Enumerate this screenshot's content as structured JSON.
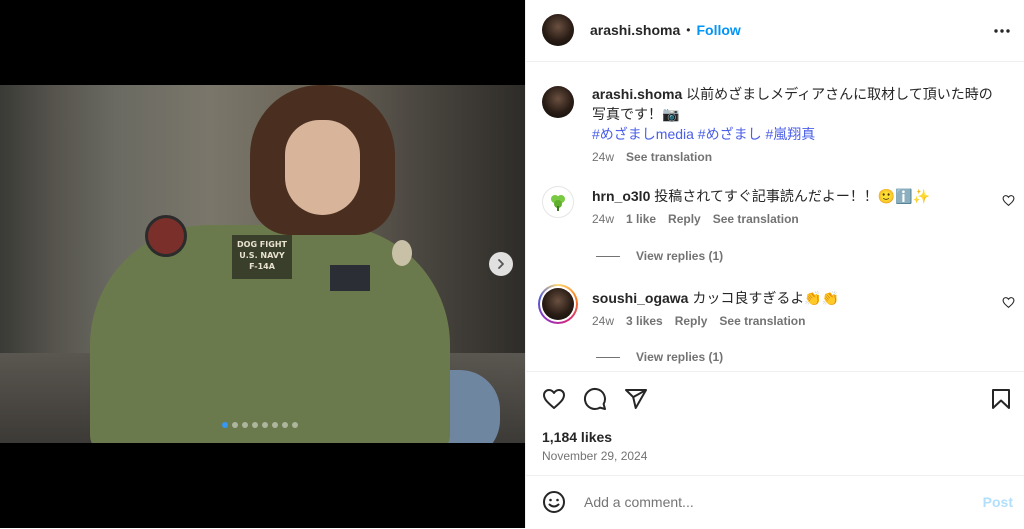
{
  "post": {
    "username": "arashi.shoma",
    "follow_label": "Follow",
    "separator": "•",
    "caption_text": "以前めざましメディアさんに取材して頂いた時の写真です！📷",
    "caption_tags": "#めざましmedia #めざまし #嵐翔真",
    "caption_age": "24w",
    "see_translation": "See translation",
    "likes": "1,184 likes",
    "date": "November 29, 2024"
  },
  "media": {
    "photo_alt": "Man in olive bomber jacket with patches",
    "patch_texts": [
      "DOG FIGHT",
      "U.S. NAVY",
      "F-14A"
    ],
    "carousel_count": 8,
    "carousel_active_index": 0
  },
  "comments": [
    {
      "username": "hrn_o3l0",
      "text": "投稿されてすぐ記事読んだよー！！🙂ℹ️✨",
      "age": "24w",
      "likes": "1 like",
      "reply": "Reply",
      "see_translation": "See translation",
      "view_replies": "View replies (1)"
    },
    {
      "username": "soushi_ogawa",
      "text": "カッコ良すぎるよ👏👏",
      "age": "24w",
      "likes": "3 likes",
      "reply": "Reply",
      "see_translation": "See translation",
      "view_replies": "View replies (1)"
    }
  ],
  "comment_box": {
    "placeholder": "Add a comment...",
    "post_label": "Post"
  },
  "icons": [
    "more-options-icon",
    "heart-icon",
    "comment-icon",
    "share-icon",
    "bookmark-icon",
    "emoji-icon",
    "chevron-right-icon"
  ],
  "colors": {
    "accent": "#0095f6",
    "tag": "#4a5ee8",
    "muted": "#737373",
    "post_disabled": "#b2dffc"
  }
}
